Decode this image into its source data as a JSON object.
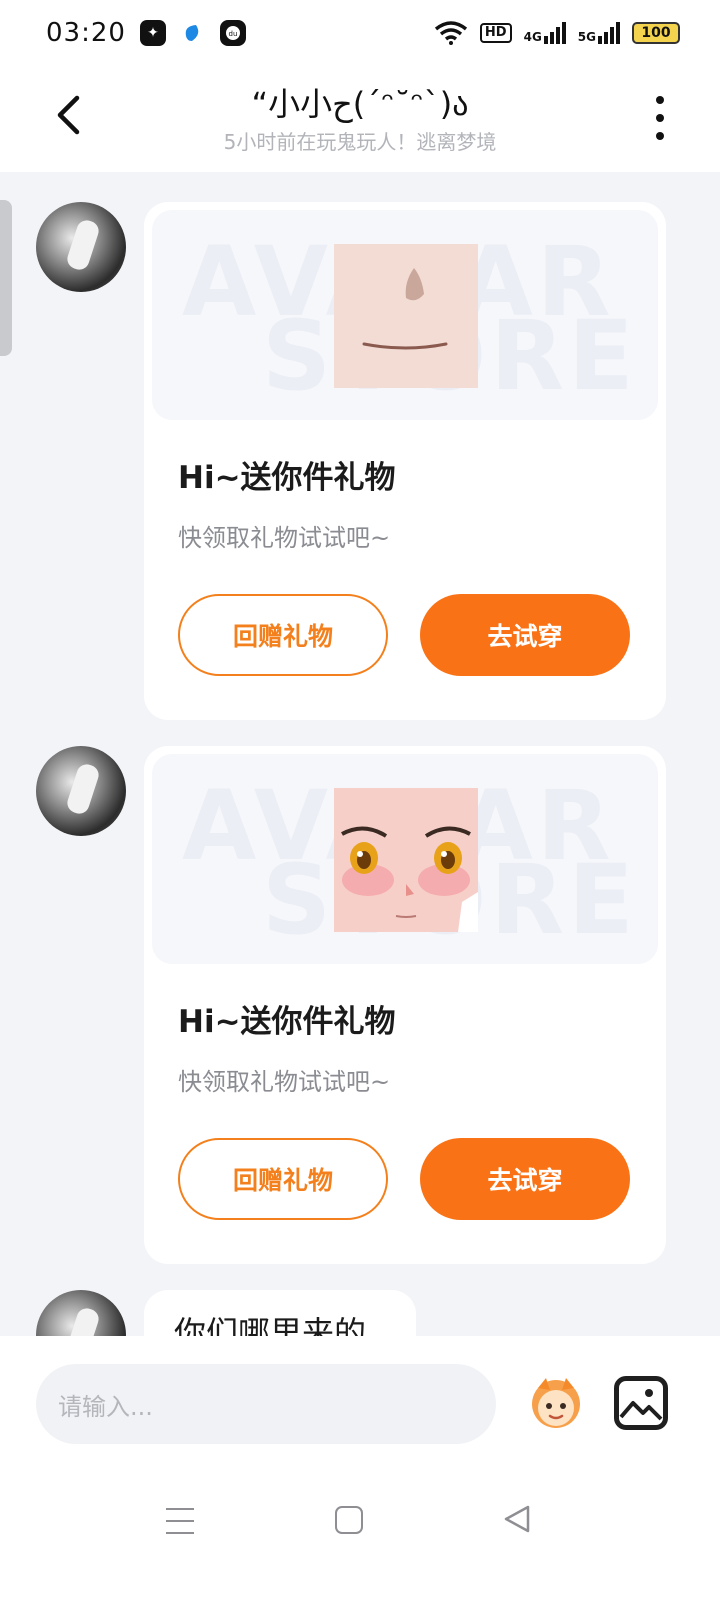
{
  "status_bar": {
    "time": "03:20",
    "hd_label": "HD",
    "net1": "4G",
    "net2": "5G",
    "battery": "100",
    "app_icons": [
      "sparkle-app-icon",
      "blue-drop-app-icon",
      "du-app-icon"
    ]
  },
  "header": {
    "title": "“小小ح(ˊᵔ˘ᵔˋ)ა",
    "subtitle": "5小时前在玩鬼玩人！逃离梦境"
  },
  "messages": [
    {
      "type": "gift",
      "title": "Hi~送你件礼物",
      "subtitle": "快领取礼物试试吧~",
      "return_gift_label": "回赠礼物",
      "try_on_label": "去试穿",
      "watermark_top": "AVATAR",
      "watermark_bottom": "STORE",
      "item_icon": "face-mouth-icon"
    },
    {
      "type": "gift",
      "title": "Hi~送你件礼物",
      "subtitle": "快领取礼物试试吧~",
      "return_gift_label": "回赠礼物",
      "try_on_label": "去试穿",
      "watermark_top": "AVATAR",
      "watermark_bottom": "STORE",
      "item_icon": "anime-face-icon"
    },
    {
      "type": "text",
      "text": "你们哪里来的"
    }
  ],
  "input": {
    "placeholder": "请输入..."
  },
  "colors": {
    "accent": "#f97316",
    "background": "#f3f4f8"
  }
}
